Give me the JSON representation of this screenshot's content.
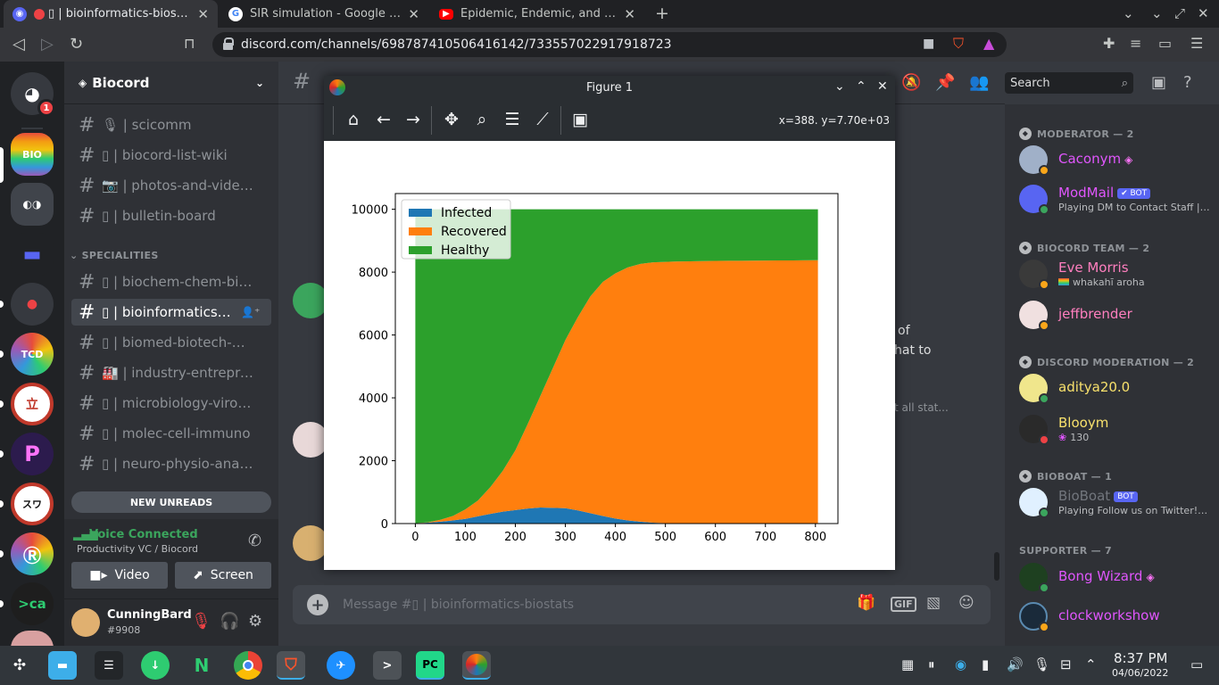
{
  "browser": {
    "tabs": [
      {
        "label": "▯ | bioinformatics-biostats",
        "close": "✕"
      },
      {
        "label": "SIR simulation - Google Search",
        "close": "✕"
      },
      {
        "label": "Epidemic, Endemic, and Eradicatio",
        "close": "✕"
      }
    ],
    "new_tab": "+",
    "url": "discord.com/channels/698787410506416142/733557022917918723"
  },
  "discord": {
    "server_badge": "1",
    "guild_name": "Biocord",
    "channels_top": [
      {
        "label": "🎙 | scicomm"
      },
      {
        "label": "▯ | biocord-list-wiki"
      },
      {
        "label": "📷 | photos-and-videos"
      },
      {
        "label": "▯ | bulletin-board"
      }
    ],
    "category": "SPECIALITIES",
    "channels": [
      {
        "label": "▯ | biochem-chem-biop..."
      },
      {
        "label": "▯ | bioinformatics-bios..."
      },
      {
        "label": "▯ | biomed-biotech-bio..."
      },
      {
        "label": "🏭 | industry-entrepren..."
      },
      {
        "label": "▯ | microbiology-virolog..."
      },
      {
        "label": "▯ | molec-cell-immuno"
      },
      {
        "label": "▯ | neuro-physio-anato..."
      }
    ],
    "new_unreads": "NEW UNREADS",
    "voice": {
      "status": "Voice Connected",
      "channel": "Productivity VC / Biocord",
      "video_label": "Video",
      "screen_label": "Screen"
    },
    "user": {
      "name": "CunningBard",
      "tag": "#9908"
    },
    "search_placeholder": "Search",
    "composer_placeholder": "Message #▯ | bioinformatics-biostats",
    "gif_label": "GIF",
    "msg_fragments": [
      "of",
      "hat to",
      "t all stat..."
    ],
    "member_groups": [
      {
        "title": "MODERATOR — 2",
        "members": [
          {
            "name": "Caconym",
            "sub": "",
            "color": "#e056fd"
          },
          {
            "name": "ModMail",
            "bot": "✔ BOT",
            "sub": "Playing DM to Contact Staff | ...",
            "color": "#e056fd"
          }
        ]
      },
      {
        "title": "BIOCORD TEAM — 2",
        "members": [
          {
            "name": "Eve Morris",
            "sub": "whakahī aroha",
            "color": "#ff7fbf"
          },
          {
            "name": "jeffbrender",
            "sub": "",
            "color": "#ff7fbf"
          }
        ]
      },
      {
        "title": "DISCORD MODERATION — 2",
        "members": [
          {
            "name": "aditya20.0",
            "sub": "",
            "color": "#f8e16c"
          },
          {
            "name": "Blooym",
            "sub": "130",
            "color": "#f8e16c"
          }
        ]
      },
      {
        "title": "BIOBOAT — 1",
        "members": [
          {
            "name": "BioBoat",
            "bot": "BOT",
            "sub": "Playing Follow us on Twitter! h...",
            "color": "#72767d"
          }
        ]
      },
      {
        "title": "SUPPORTER — 7",
        "members": [
          {
            "name": "Bong Wizard",
            "sub": "",
            "color": "#e056fd"
          },
          {
            "name": "clockworkshow",
            "sub": "",
            "color": "#e056fd"
          }
        ]
      }
    ]
  },
  "figure": {
    "window_title": "Figure 1",
    "coords": "x=388. y=7.70e+03"
  },
  "chart_data": {
    "type": "area",
    "stacked": true,
    "x": [
      0,
      25,
      50,
      75,
      100,
      125,
      150,
      175,
      200,
      225,
      250,
      275,
      300,
      325,
      350,
      375,
      400,
      425,
      450,
      475,
      500,
      525,
      550,
      575,
      600,
      625,
      650,
      675,
      700,
      725,
      750,
      775,
      800,
      805
    ],
    "series": [
      {
        "name": "Infected",
        "color": "#1f77b4",
        "values": [
          10,
          30,
          60,
          100,
          150,
          230,
          310,
          380,
          430,
          480,
          510,
          500,
          490,
          420,
          330,
          240,
          160,
          100,
          60,
          30,
          15,
          8,
          4,
          2,
          1,
          0,
          0,
          0,
          0,
          0,
          0,
          0,
          0,
          0
        ]
      },
      {
        "name": "Recovered",
        "color": "#ff7f0e",
        "values": [
          0,
          10,
          60,
          140,
          300,
          500,
          850,
          1300,
          1900,
          2700,
          3550,
          4450,
          5350,
          6150,
          6900,
          7450,
          7800,
          8050,
          8200,
          8280,
          8310,
          8330,
          8340,
          8350,
          8355,
          8360,
          8362,
          8365,
          8367,
          8370,
          8372,
          8375,
          8378,
          8380
        ]
      },
      {
        "name": "Healthy",
        "color": "#2ca02c",
        "values": [
          9990,
          9960,
          9880,
          9760,
          9550,
          9270,
          8840,
          8320,
          7670,
          6820,
          5940,
          5050,
          4160,
          3430,
          2770,
          2310,
          2040,
          1850,
          1740,
          1690,
          1675,
          1662,
          1656,
          1648,
          1644,
          1640,
          1638,
          1635,
          1633,
          1630,
          1628,
          1625,
          1622,
          1620
        ]
      }
    ],
    "xticks": [
      0,
      100,
      200,
      300,
      400,
      500,
      600,
      700,
      800
    ],
    "yticks": [
      0,
      2000,
      4000,
      6000,
      8000,
      10000
    ],
    "xlim": [
      -40,
      845
    ],
    "ylim": [
      0,
      10500
    ],
    "legend": "top-left",
    "grid": false
  },
  "taskbar": {
    "time": "8:37 PM",
    "date": "04/06/2022"
  }
}
